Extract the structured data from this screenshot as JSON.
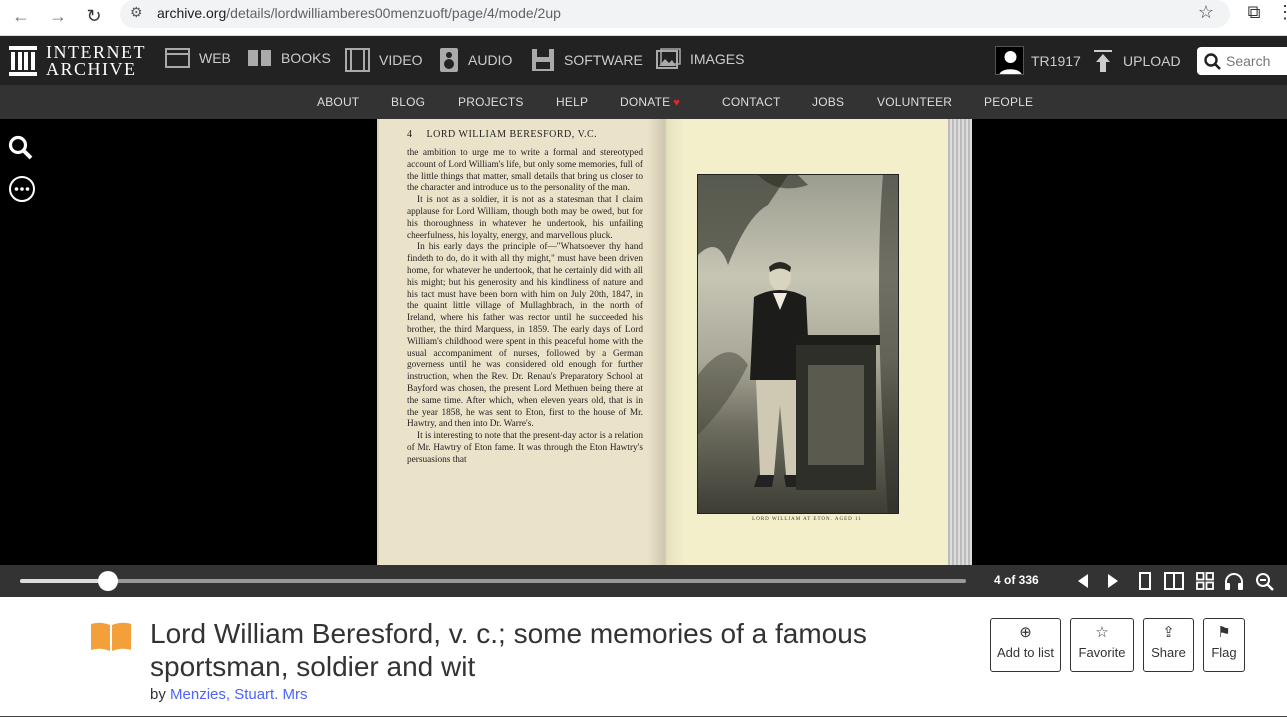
{
  "browser": {
    "url_domain": "archive.org",
    "url_path": "/details/lordwilliamberes00menzuoft/page/4/mode/2up"
  },
  "ia_header": {
    "logo_line1": "INTERNET",
    "logo_line2": "ARCHIVE",
    "nav": [
      "WEB",
      "BOOKS",
      "VIDEO",
      "AUDIO",
      "SOFTWARE",
      "IMAGES"
    ],
    "username": "TR1917",
    "upload_label": "UPLOAD",
    "search_placeholder": "Search"
  },
  "sub_nav": [
    "ABOUT",
    "BLOG",
    "PROJECTS",
    "HELP",
    "DONATE",
    "CONTACT",
    "JOBS",
    "VOLUNTEER",
    "PEOPLE"
  ],
  "book_page": {
    "page_number": "4",
    "running_head": "LORD WILLIAM BERESFORD, V.C.",
    "paragraphs": [
      "the ambition to urge me to write a formal and stereotyped account of Lord William's life, but only some memories, full of the little things that matter, small details that bring us closer to the character and introduce us to the personality of the man.",
      "It is not as a soldier, it is not as a statesman that I claim applause for Lord William, though both may be owed, but for his thoroughness in whatever he undertook, his unfailing cheerfulness, his loyalty, energy, and marvellous pluck.",
      "In his early days the principle of—\"Whatsoever thy hand findeth to do, do it with all thy might,\" must have been driven home, for whatever he undertook, that he certainly did with all his might; but his generosity and his kindliness of nature and his tact must have been born with him on July 20th, 1847, in the quaint little village of Mullaghbrach, in the north of Ireland, where his father was rector until he succeeded his brother, the third Marquess, in 1859. The early days of Lord William's childhood were spent in this peaceful home with the usual accompaniment of nurses, followed by a German governess until he was considered old enough for further instruction, when the Rev. Dr. Renau's Preparatory School at Bayford was chosen, the present Lord Methuen being there at the same time. After which, when eleven years old, that is in the year 1858, he was sent to Eton, first to the house of Mr. Hawtry, and then into Dr. Warre's.",
      "It is interesting to note that the present-day actor is a relation of Mr. Hawtry of Eton fame. It was through the Eton Hawtry's persuasions that"
    ],
    "plate_caption": "LORD WILLIAM AT ETON. AGED 11"
  },
  "reader": {
    "page_indicator": "4 of 336",
    "progress_fraction": 0.058
  },
  "item": {
    "title": "Lord William Beresford, v. c.; some memories of a famous sportsman, soldier and wit",
    "by_prefix": "by",
    "author": "Menzies, Stuart. Mrs",
    "actions": [
      "Add to list",
      "Favorite",
      "Share",
      "Flag"
    ]
  }
}
